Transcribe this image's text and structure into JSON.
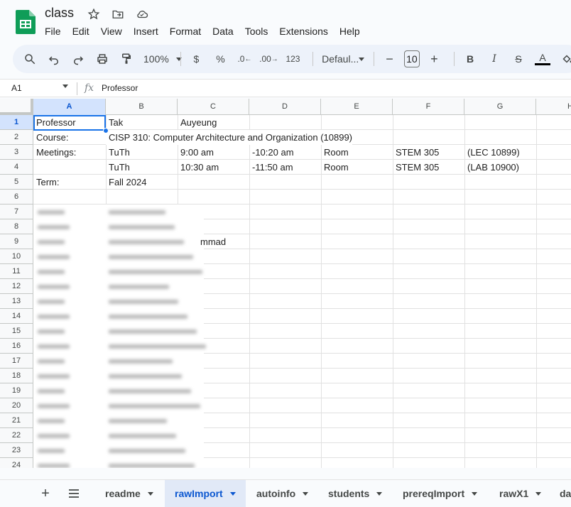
{
  "doc": {
    "title": "class"
  },
  "menu": [
    "File",
    "Edit",
    "View",
    "Insert",
    "Format",
    "Data",
    "Tools",
    "Extensions",
    "Help"
  ],
  "toolbar": {
    "zoom": "100%",
    "currency": "$",
    "percent": "%",
    "dec_decrease": ".0",
    "dec_increase": ".00",
    "number_format": "123",
    "font": "Defaul...",
    "font_size": "10",
    "bold": "B",
    "italic": "I",
    "text_color": "A"
  },
  "formula_bar": {
    "cell_ref": "A1",
    "fx": "fx",
    "value": "Professor"
  },
  "columns": [
    "A",
    "B",
    "C",
    "D",
    "E",
    "F",
    "G",
    "H"
  ],
  "rows": [
    "1",
    "2",
    "3",
    "4",
    "5",
    "6",
    "7",
    "8",
    "9",
    "10",
    "11",
    "12",
    "13",
    "14",
    "15",
    "16",
    "17",
    "18",
    "19",
    "20",
    "21",
    "22",
    "23",
    "24"
  ],
  "cells": {
    "r1": {
      "a": "Professor",
      "b": "Tak",
      "c": "Auyeung"
    },
    "r2": {
      "a": "Course:",
      "b": "CISP 310: Computer Architecture and Organization (10899)"
    },
    "r3": {
      "a": "Meetings:",
      "b": "TuTh",
      "c": "9:00 am",
      "d": "-10:20 am",
      "e": "Room",
      "f": "STEM 305",
      "g": "(LEC 10899)"
    },
    "r4": {
      "b": "TuTh",
      "c": "10:30 am",
      "d": "-11:50 am",
      "e": "Room",
      "f": "STEM 305",
      "g": "(LAB 10900)"
    },
    "r5": {
      "a": "Term:",
      "b": "Fall 2024"
    },
    "r9_tail": "mmad"
  },
  "sheets": [
    "readme",
    "rawImport",
    "autoinfo",
    "students",
    "prereqImport",
    "rawX1",
    "da"
  ]
}
